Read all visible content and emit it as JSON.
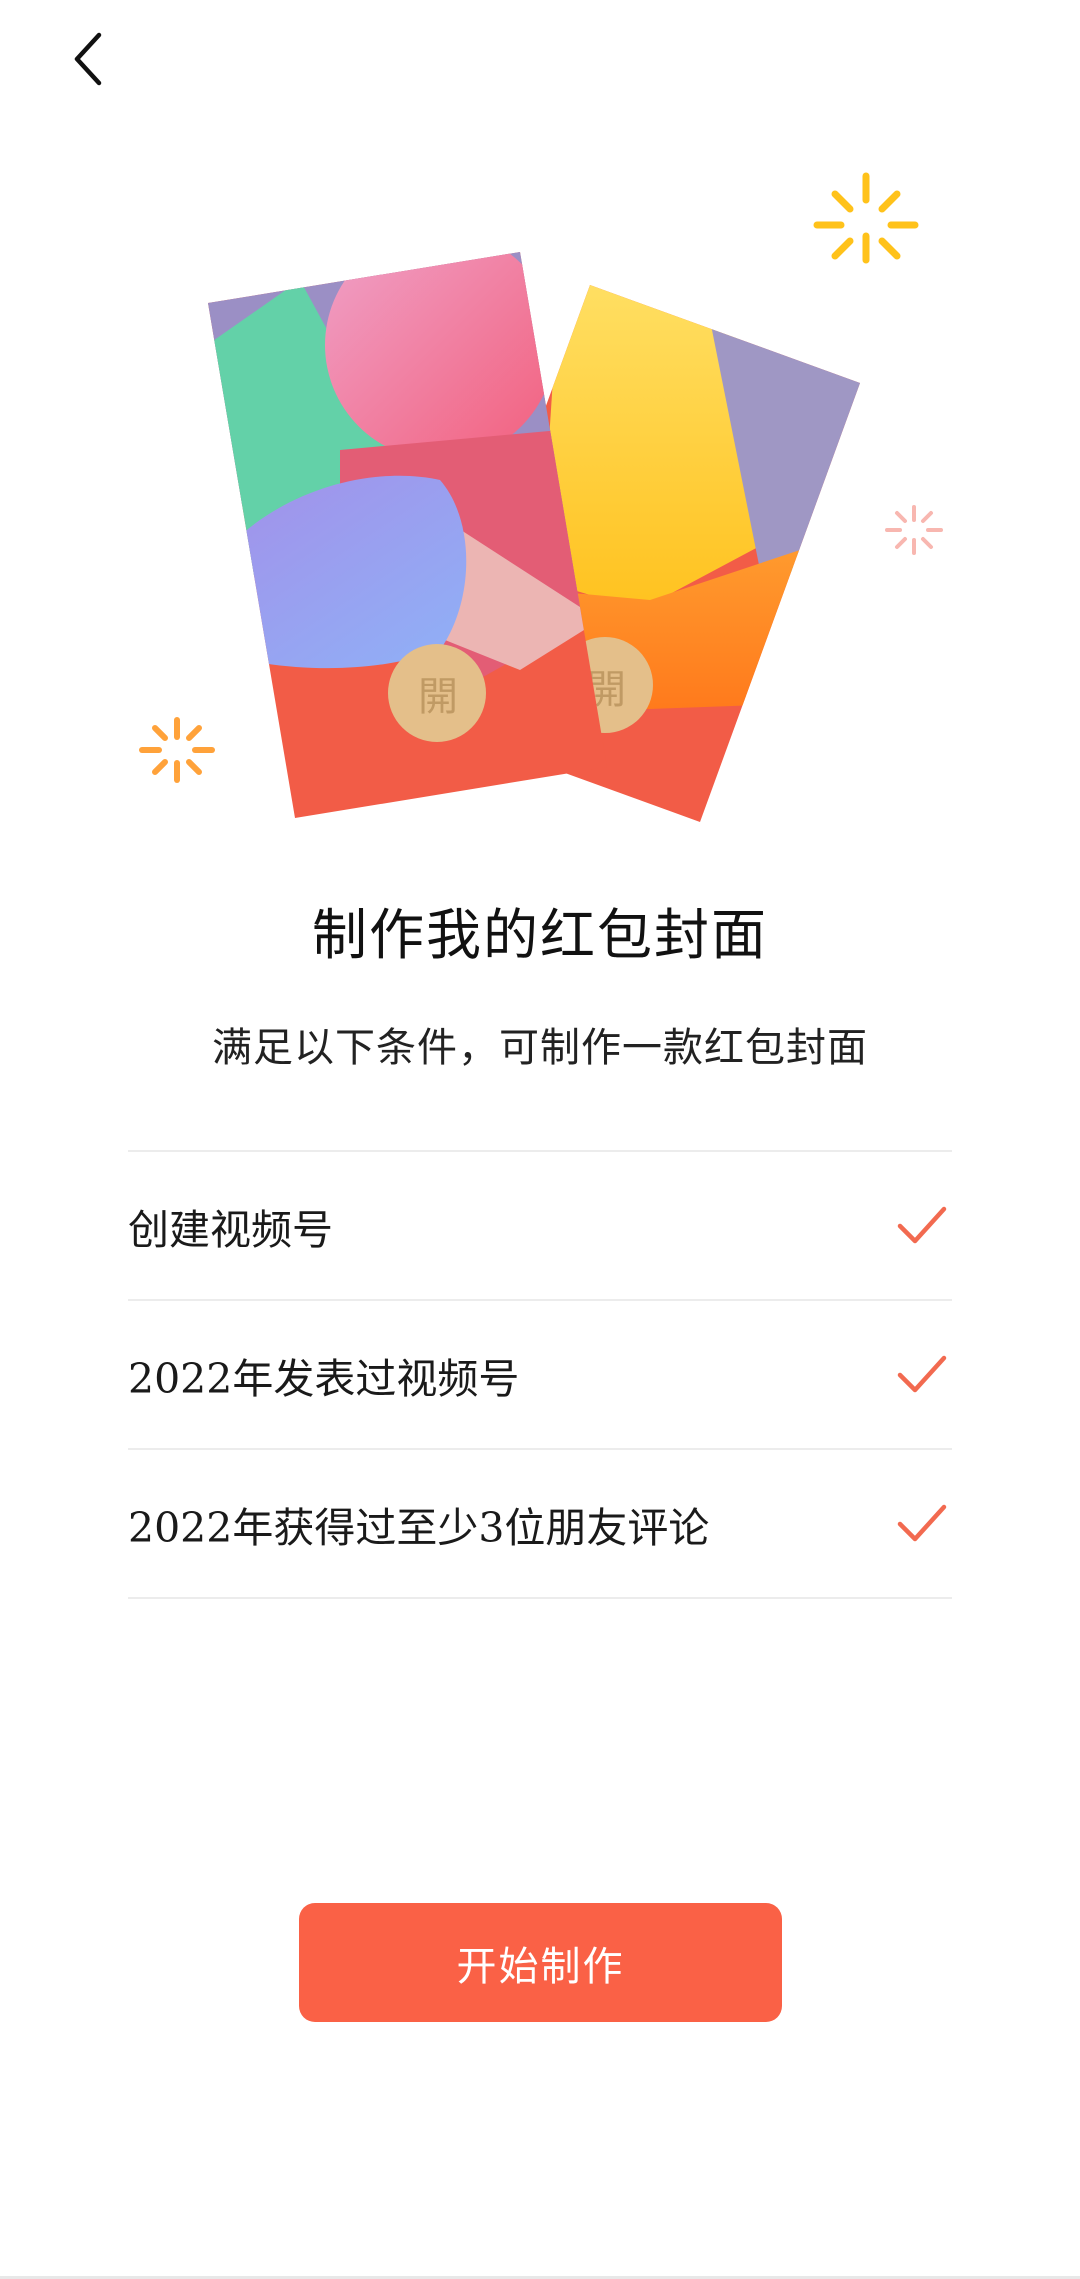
{
  "header": {
    "back_icon": "chevron-left-icon"
  },
  "hero": {
    "back_card_seal": "開",
    "front_card_seal": "開",
    "sparkle_icon": "sparkle-icon"
  },
  "title": "制作我的红包封面",
  "subtitle": "满足以下条件，可制作一款红包封面",
  "conditions": [
    {
      "label": "创建视频号",
      "met": true
    },
    {
      "label": "2022年发表过视频号",
      "met": true
    },
    {
      "label": "2022年获得过至少3位朋友评论",
      "met": true
    }
  ],
  "start_button": {
    "label": "开始制作"
  },
  "colors": {
    "accent": "#fa6146",
    "check": "#f26a50",
    "divider": "#ececec",
    "sparkle_yellow": "#ffc21a",
    "sparkle_orange": "#ffa23a",
    "sparkle_pink": "#f8b7b0"
  }
}
